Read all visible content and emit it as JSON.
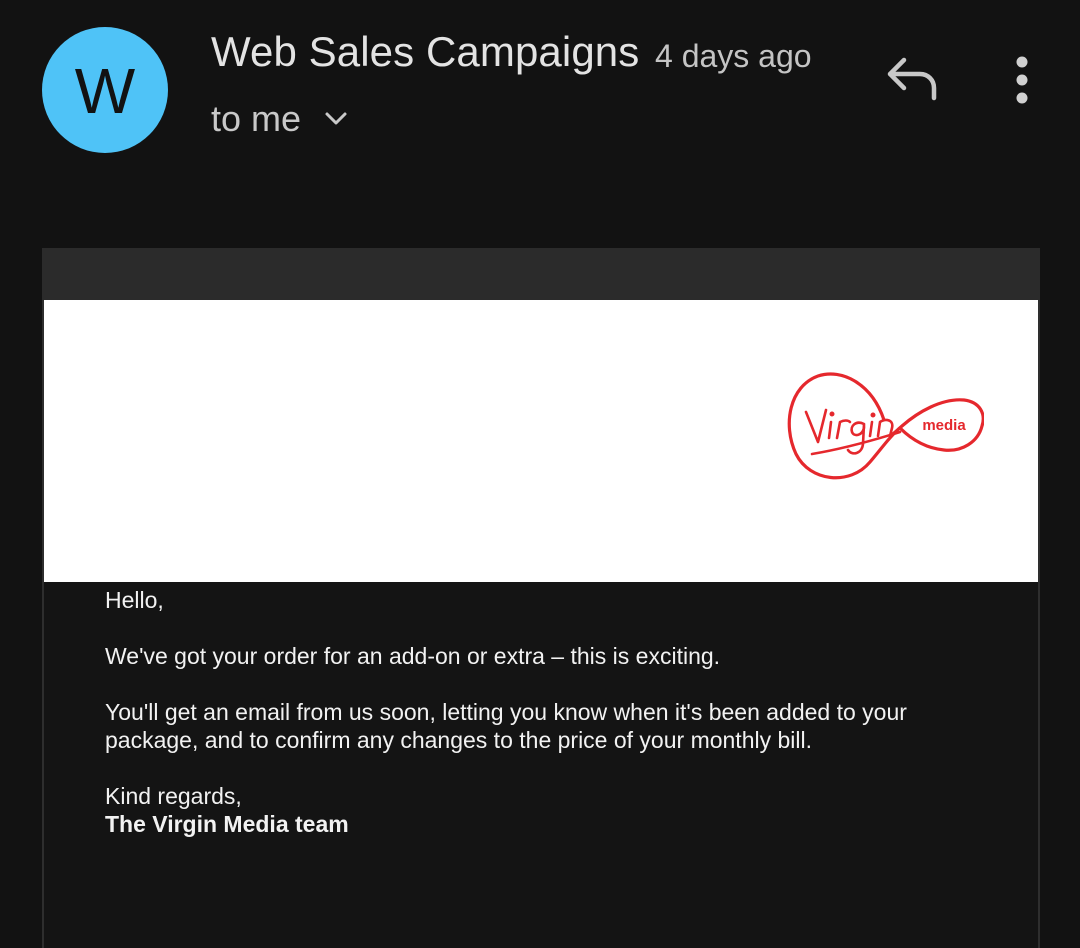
{
  "message": {
    "avatar_letter": "W",
    "avatar_color": "#4fc3f7",
    "sender": "Web Sales Campaigns",
    "time": "4 days ago",
    "recipient": "to me",
    "icons": {
      "reply": "reply-icon",
      "more": "more-vert-icon",
      "expand": "chevron-down-icon"
    }
  },
  "email": {
    "brand_logo": "Virgin media",
    "brand_color": "#e5282d",
    "greeting": "Hello,",
    "paragraph1": "We've got your order for an add-on or extra – this is exciting.",
    "paragraph2": "You'll get an email from us soon, letting you know when it's been added to your package, and to confirm any changes to the price of your monthly bill.",
    "signoff": "Kind regards,",
    "team": "The Virgin Media team"
  }
}
